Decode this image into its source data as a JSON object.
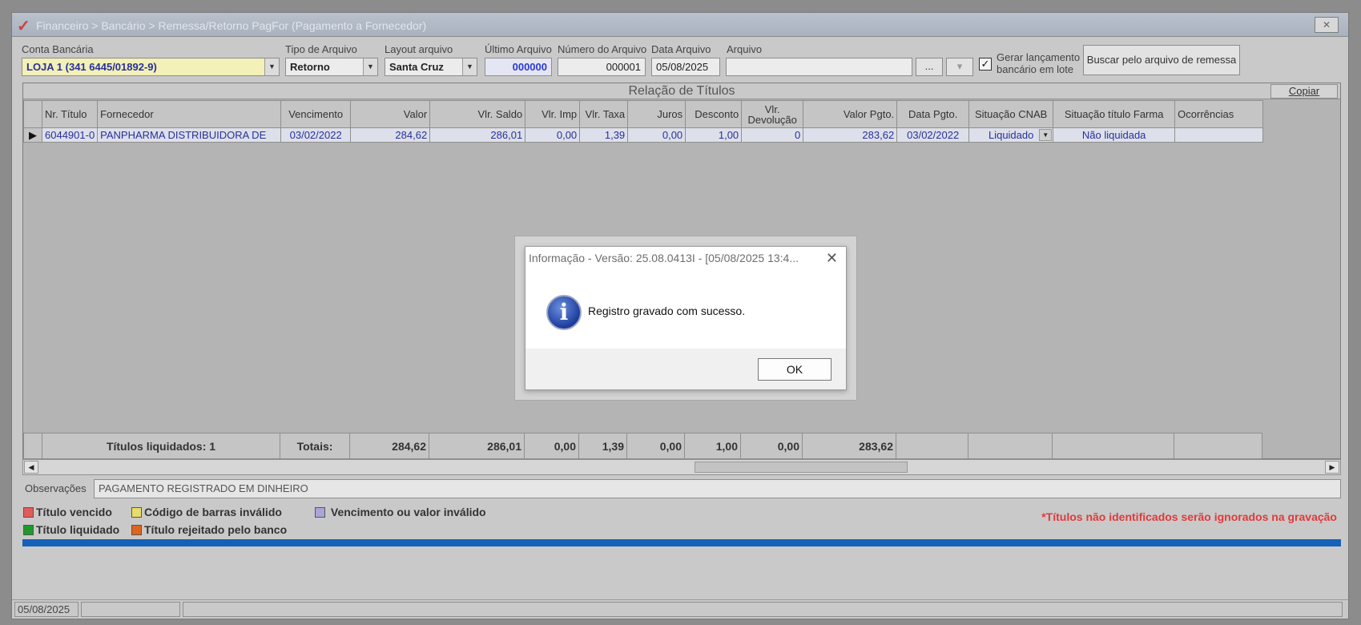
{
  "window": {
    "title": "Financeiro > Bancário > Remessa/Retorno PagFor (Pagamento  a Fornecedor)"
  },
  "filters": {
    "conta_label": "Conta Bancária",
    "conta_value": "LOJA 1 (341 6445/01892-9)",
    "tipo_label": "Tipo de Arquivo",
    "tipo_value": "Retorno",
    "layout_label": "Layout arquivo",
    "layout_value": "Santa Cruz",
    "ultimo_label": "Último Arquivo",
    "ultimo_value": "000000",
    "numero_label": "Número do Arquivo",
    "numero_value": "000001",
    "data_label": "Data Arquivo",
    "data_value": "05/08/2025",
    "arquivo_label": "Arquivo",
    "arquivo_value": "",
    "browse_label": "...",
    "dropdown_label": "▾",
    "gerar_label_1": "Gerar lançamento",
    "gerar_label_2": "bancário em lote",
    "buscar_label": "Buscar pelo arquivo de remessa"
  },
  "grid": {
    "caption": "Relação de Títulos",
    "copy_label": "Copiar",
    "columns": [
      "Nr. Título",
      "Fornecedor",
      "Vencimento",
      "Valor",
      "Vlr. Saldo",
      "Vlr. Imp",
      "Vlr. Taxa",
      "Juros",
      "Desconto",
      "Vlr. Devolução",
      "Valor Pgto.",
      "Data Pgto.",
      "Situação CNAB",
      "Situação título Farma",
      "Ocorrências"
    ],
    "rows": [
      {
        "nr_titulo": "6044901-0",
        "fornecedor": "PANPHARMA DISTRIBUIDORA DE",
        "vencimento": "03/02/2022",
        "valor": "284,62",
        "saldo": "286,01",
        "imp": "0,00",
        "taxa": "1,39",
        "juros": "0,00",
        "desconto": "1,00",
        "devolucao": "0",
        "valor_pgto": "283,62",
        "data_pgto": "03/02/2022",
        "situacao_cnab": "Liquidado",
        "situacao_farma": "Não liquidada",
        "ocorrencias": ""
      }
    ],
    "totals": {
      "liquidados": "Títulos liquidados: 1",
      "totais_label": "Totais:",
      "valor": "284,62",
      "saldo": "286,01",
      "imp": "0,00",
      "taxa": "1,39",
      "juros": "0,00",
      "desconto": "1,00",
      "devolucao": "0,00",
      "valor_pgto": "283,62"
    }
  },
  "observacoes": {
    "label": "Observações",
    "value": "PAGAMENTO REGISTRADO EM DINHEIRO"
  },
  "legend": {
    "items": [
      {
        "label": "Título vencido",
        "color": "#e25a5a"
      },
      {
        "label": "Código de barras inválido",
        "color": "#e8dd6a"
      },
      {
        "label": "Vencimento ou valor inválido",
        "color": "#a8a6d8"
      },
      {
        "label": "Título liquidado",
        "color": "#1f9a2a"
      },
      {
        "label": "Título rejeitado pelo banco",
        "color": "#e0641e"
      }
    ],
    "warning": "*Títulos não identificados serão ignorados na gravação"
  },
  "statusbar": {
    "date": "05/08/2025"
  },
  "dialog": {
    "title": "Informação - Versão: 25.08.0413I - [05/08/2025 13:4...",
    "message": "Registro gravado com sucesso.",
    "ok_label": "OK"
  },
  "colors": {
    "accent_blue": "#1560b8",
    "grid_text": "#28309a",
    "warning_red": "#e23a3a"
  }
}
